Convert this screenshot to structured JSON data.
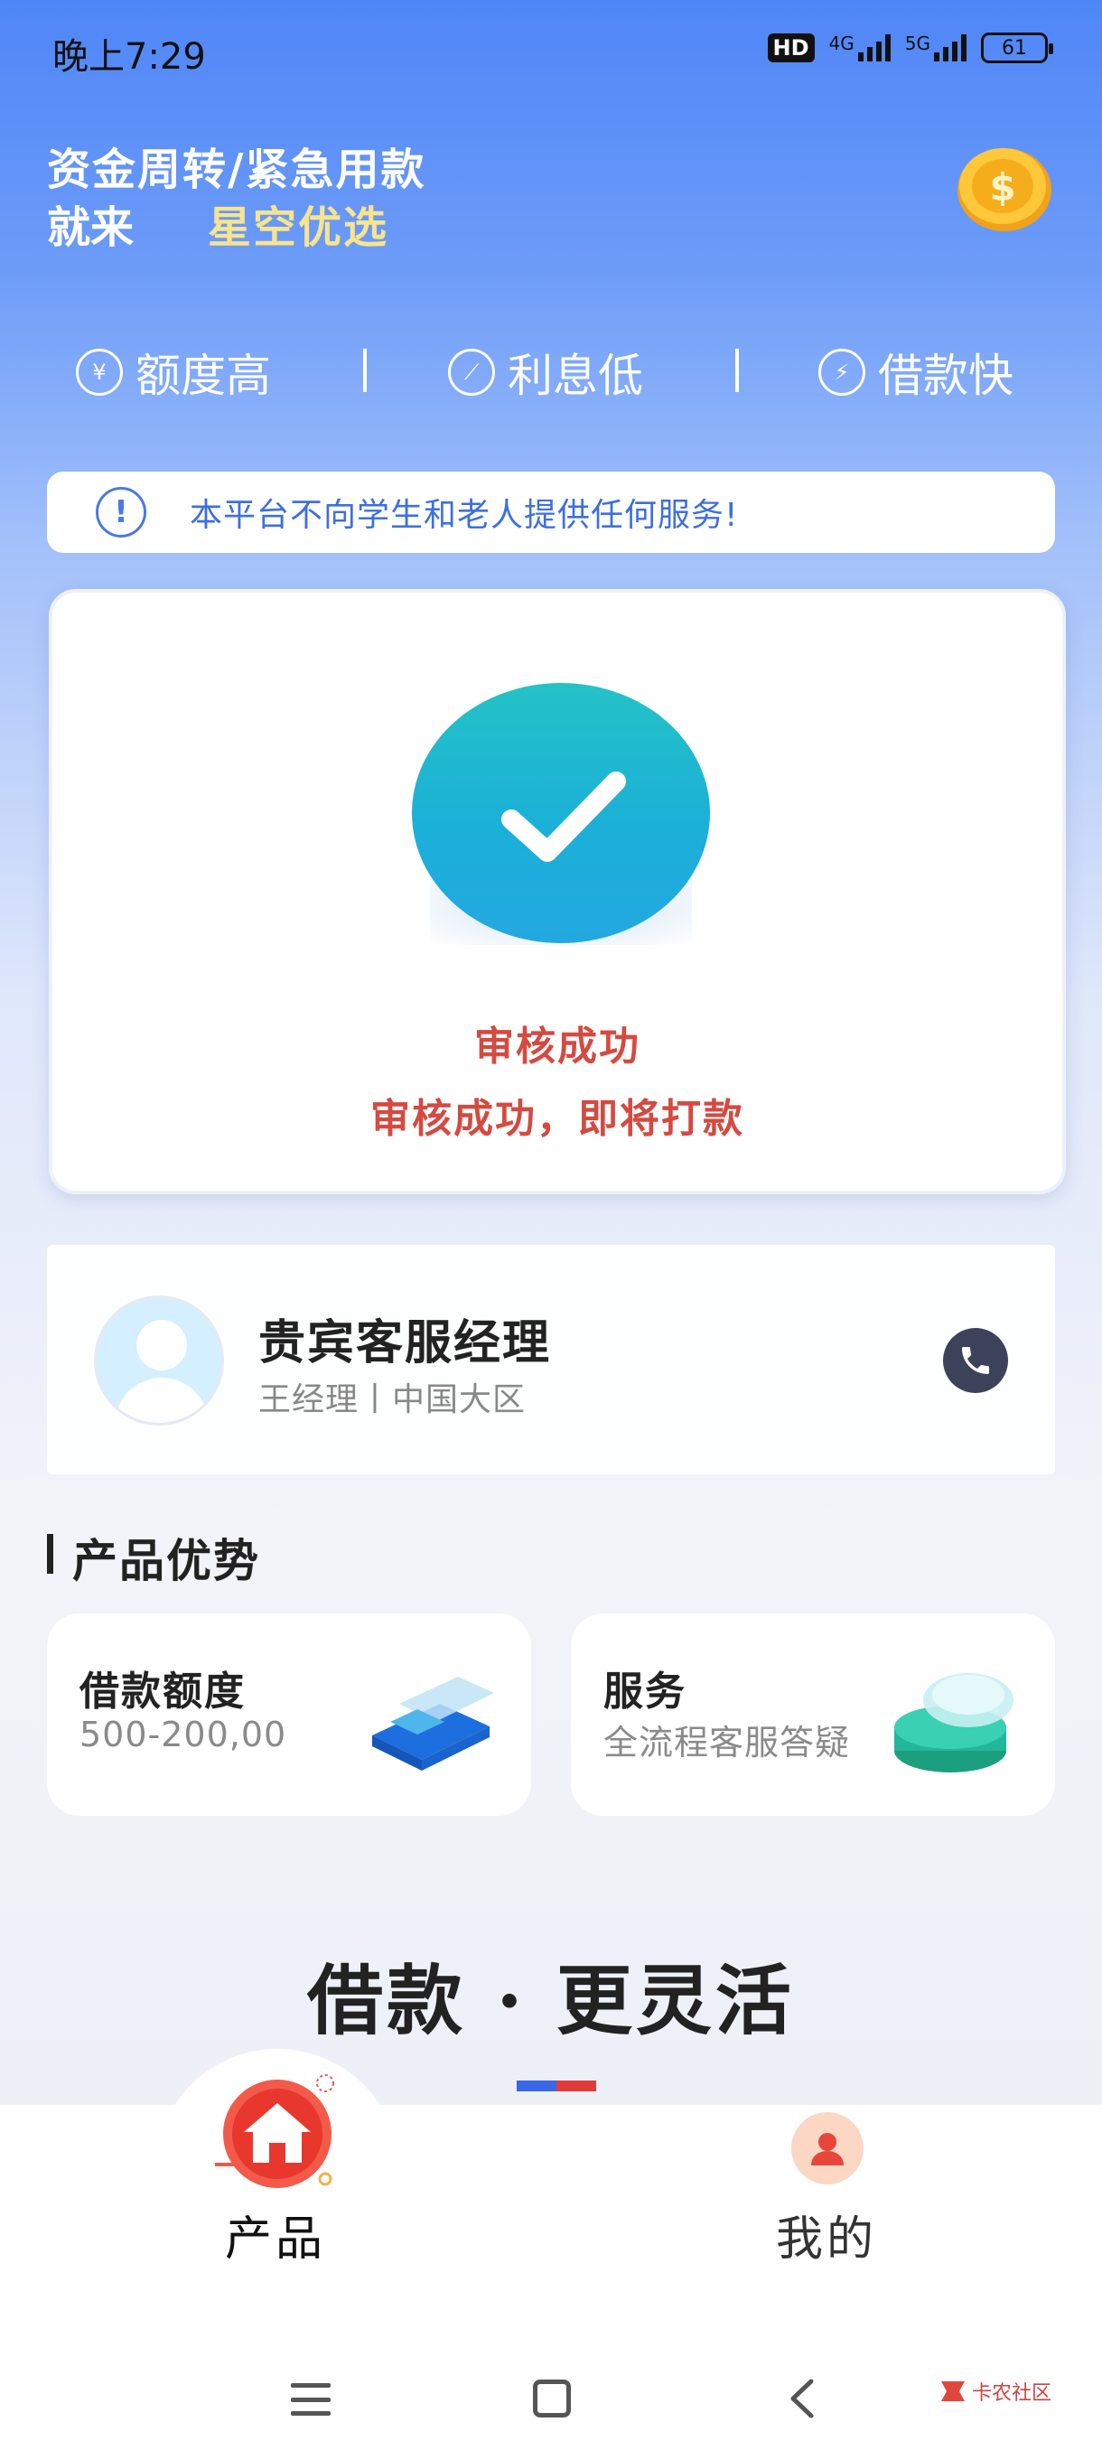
{
  "status_bar": {
    "time": "晚上7:29",
    "hd_label": "HD",
    "network_1": "4G",
    "network_2": "5G",
    "battery": "61"
  },
  "header": {
    "line1": "资金周转/紧急用款",
    "line2": "就来",
    "brand": "星空优选",
    "coin_icon": "dollar-coin-icon"
  },
  "features": [
    {
      "label": "额度高",
      "icon": "money-bag-icon"
    },
    {
      "label": "利息低",
      "icon": "stairs-icon"
    },
    {
      "label": "借款快",
      "icon": "lightning-icon"
    }
  ],
  "notice": {
    "text": "本平台不向学生和老人提供任何服务!",
    "icon": "exclamation-icon"
  },
  "status_card": {
    "icon": "checkmark-icon",
    "title": "审核成功",
    "subtitle": "审核成功，即将打款"
  },
  "manager": {
    "title": "贵宾客服经理",
    "subtitle": "王经理丨中国大区",
    "icon": "phone-icon"
  },
  "advantages": {
    "title": "产品优势",
    "items": [
      {
        "label": "借款额度",
        "value": "500-200,00",
        "icon": "cards-icon"
      },
      {
        "label": "服务",
        "value": "全流程客服答疑",
        "icon": "coin-stack-icon"
      }
    ]
  },
  "slogan": {
    "text": "借款 · 更灵活"
  },
  "tabbar": {
    "tabs": [
      {
        "label": "产品",
        "icon": "home-icon"
      },
      {
        "label": "我的",
        "icon": "user-icon"
      }
    ]
  },
  "watermark": {
    "text": "卡农社区"
  },
  "colors": {
    "primary_blue": "#4f86f7",
    "brand_yellow": "#f8e48d",
    "success_red": "#d54a40",
    "check_teal": "#1bb0d8"
  }
}
